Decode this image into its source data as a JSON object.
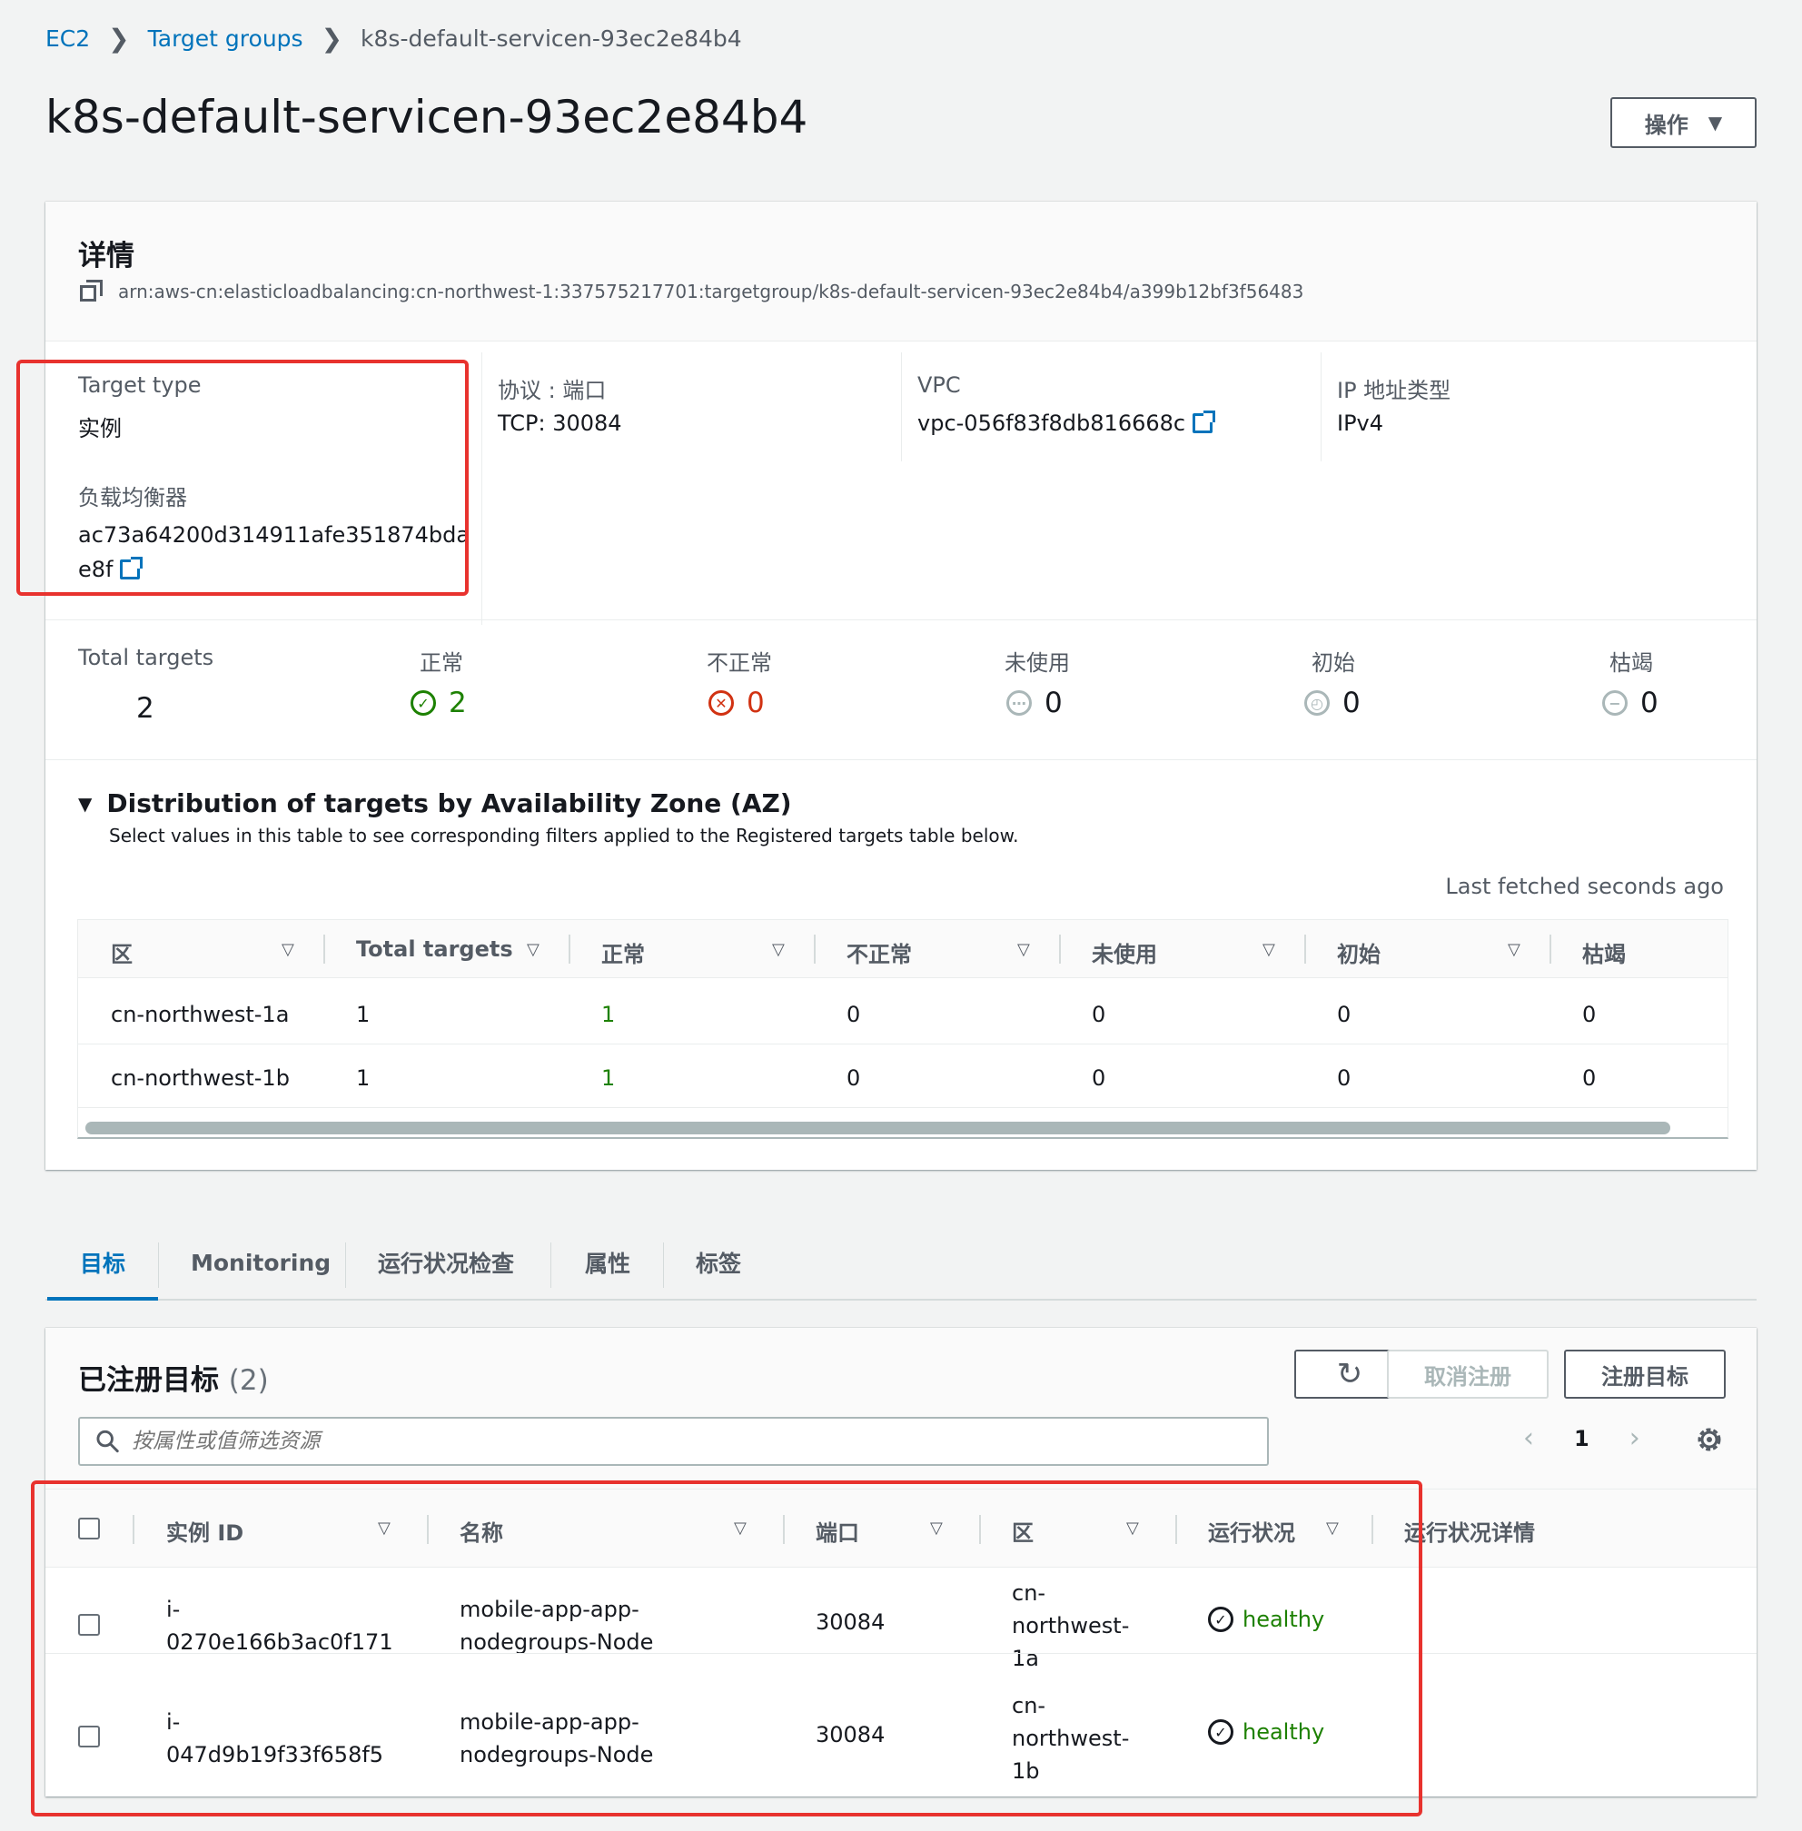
{
  "breadcrumb": {
    "ec2": "EC2",
    "target_groups": "Target groups",
    "current": "k8s-default-servicen-93ec2e84b4"
  },
  "page_title": "k8s-default-servicen-93ec2e84b4",
  "actions_label": "操作",
  "details": {
    "title": "详情",
    "arn": "arn:aws-cn:elasticloadbalancing:cn-northwest-1:337575217701:targetgroup/k8s-default-servicen-93ec2e84b4/a399b12bf3f56483",
    "target_type_label": "Target type",
    "target_type_value": "实例",
    "lb_label": "负载均衡器",
    "lb_value_line1": "ac73a64200d314911afe351874bda",
    "lb_value_line2": "e8f",
    "protocol_label": "协议 : 端口",
    "protocol_value": "TCP: 30084",
    "vpc_label": "VPC",
    "vpc_value": "vpc-056f83f8db816668c",
    "ip_label": "IP 地址类型",
    "ip_value": "IPv4"
  },
  "stats": {
    "total_label": "Total targets",
    "total_value": "2",
    "healthy_label": "正常",
    "healthy_value": "2",
    "unhealthy_label": "不正常",
    "unhealthy_value": "0",
    "unused_label": "未使用",
    "unused_value": "0",
    "initial_label": "初始",
    "initial_value": "0",
    "draining_label": "枯竭",
    "draining_value": "0"
  },
  "distribution": {
    "title": "Distribution of targets by Availability Zone (AZ)",
    "subtitle": "Select values in this table to see corresponding filters applied to the Registered targets table below.",
    "last_fetched": "Last fetched seconds ago",
    "headers": [
      "区",
      "Total targets",
      "正常",
      "不正常",
      "未使用",
      "初始",
      "枯竭"
    ],
    "rows": [
      [
        "cn-northwest-1a",
        "1",
        "1",
        "0",
        "0",
        "0",
        "0"
      ],
      [
        "cn-northwest-1b",
        "1",
        "1",
        "0",
        "0",
        "0",
        "0"
      ]
    ]
  },
  "tabs": [
    "目标",
    "Monitoring",
    "运行状况检查",
    "属性",
    "标签"
  ],
  "targets": {
    "title": "已注册目标",
    "count": "(2)",
    "deregister_label": "取消注册",
    "register_label": "注册目标",
    "search_placeholder": "按属性或值筛选资源",
    "page": "1",
    "headers": [
      "实例 ID",
      "名称",
      "端口",
      "区",
      "运行状况",
      "运行状况详情"
    ],
    "rows": [
      {
        "id_line1": "i-",
        "id_line2": "0270e166b3ac0f171",
        "name_line1": "mobile-app-app-",
        "name_line2": "nodegroups-Node",
        "port": "30084",
        "zone_line1": "cn-",
        "zone_line2": "northwest-",
        "zone_line3": "1a",
        "status": "healthy"
      },
      {
        "id_line1": "i-",
        "id_line2": "047d9b19f33f658f5",
        "name_line1": "mobile-app-app-",
        "name_line2": "nodegroups-Node",
        "port": "30084",
        "zone_line1": "cn-",
        "zone_line2": "northwest-",
        "zone_line3": "1b",
        "status": "healthy"
      }
    ]
  },
  "colors": {
    "link": "#0073bb",
    "healthy": "#1d8102",
    "unhealthy": "#d13212",
    "highlight": "#e8322e"
  }
}
